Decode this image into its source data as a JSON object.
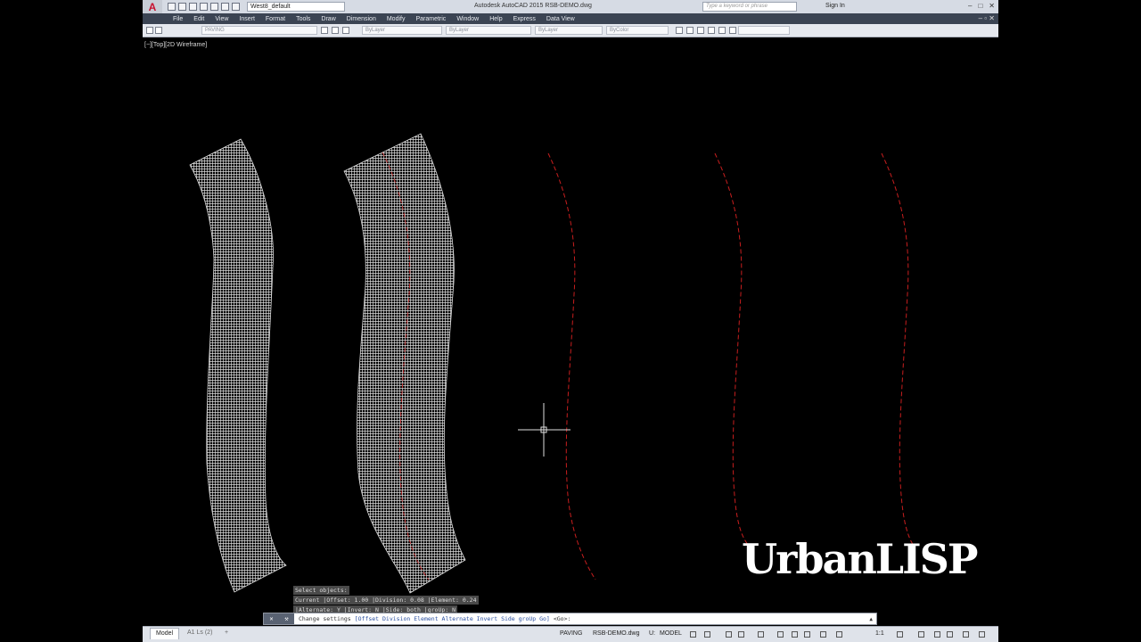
{
  "titlebar": {
    "workspace": "West8_default",
    "app_title": "Autodesk AutoCAD 2015    RSB-DEMO.dwg",
    "search_placeholder": "Type a keyword or phrase",
    "signin": "Sign In"
  },
  "menubar": {
    "items": [
      "File",
      "Edit",
      "View",
      "Insert",
      "Format",
      "Tools",
      "Draw",
      "Dimension",
      "Modify",
      "Parametric",
      "Window",
      "Help",
      "Express",
      "Data View"
    ]
  },
  "toolbar": {
    "layer": "PAVING",
    "color": "ByLayer",
    "linetype": "ByLayer",
    "lineweight": "ByLayer",
    "plotstyle": "ByColor"
  },
  "viewport": {
    "label": "[−][Top][2D Wireframe]"
  },
  "command": {
    "history": [
      "Select objects:",
      "Current |Offset: 1.00 |Division: 0.08 |Element: 0.24",
      "|Alternate: Y |Invert: N |Side: both |groUp: N"
    ],
    "prompt": "Change settings",
    "options": "[Offset Division Element Alternate Invert Side groUp Go]",
    "default": "<Go>:"
  },
  "statusbar": {
    "tab_model": "Model",
    "tab_layout": "A1 Ls (2)",
    "tab_add": "+",
    "layer": "PAVING",
    "file": "RSB-DEMO.dwg",
    "units": "U:",
    "space": "MODEL",
    "scale": "1:1"
  },
  "brand": "UrbanLISP",
  "colors": {
    "canvas": "#000000",
    "hatch": "#d9d9d9",
    "centerline": "#c81e1e"
  }
}
